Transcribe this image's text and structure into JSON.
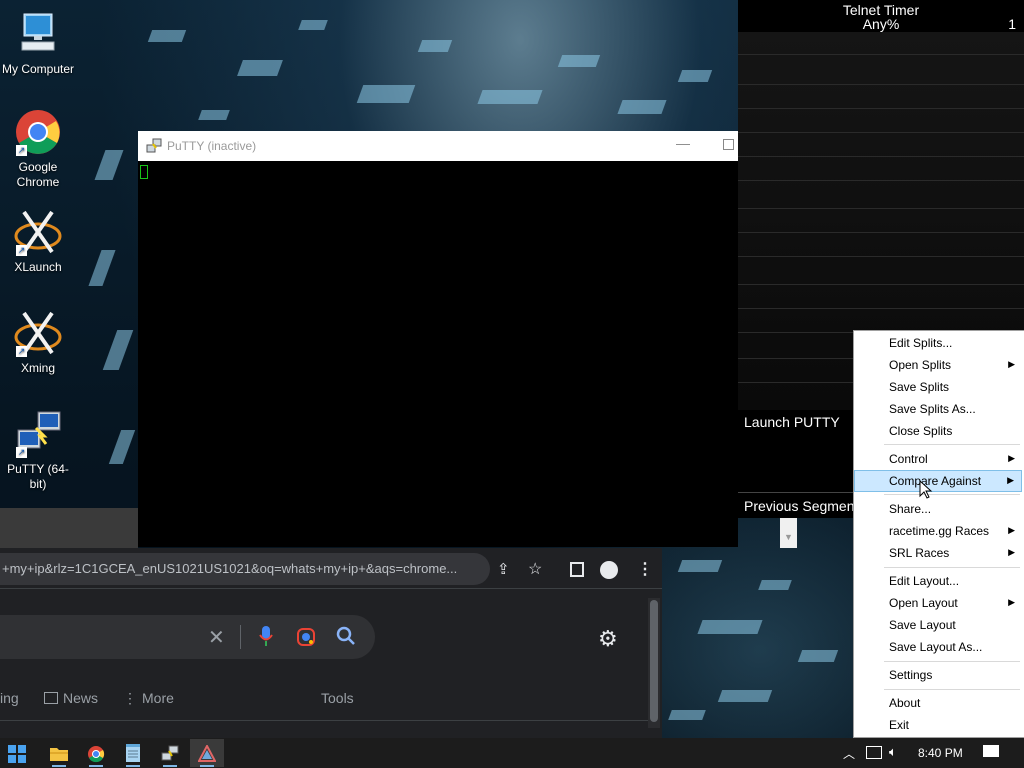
{
  "desktop": {
    "icons": [
      {
        "label": "My Computer"
      },
      {
        "label": "Google Chrome"
      },
      {
        "label": "XLaunch"
      },
      {
        "label": "Xming"
      },
      {
        "label": "PuTTY (64-bit)"
      }
    ]
  },
  "putty": {
    "title": "PuTTY (inactive)",
    "minimize_icon": "minimize-icon",
    "maximize_icon": "maximize-icon"
  },
  "livesplit": {
    "game": "Telnet Timer",
    "category": "Any%",
    "attempts": "1",
    "segment_label": "Launch PUTTY",
    "previous_segment_label": "Previous Segment"
  },
  "context_menu": {
    "items": [
      {
        "label": "Edit Splits...",
        "submenu": false
      },
      {
        "label": "Open Splits",
        "submenu": true
      },
      {
        "label": "Save Splits",
        "submenu": false
      },
      {
        "label": "Save Splits As...",
        "submenu": false
      },
      {
        "label": "Close Splits",
        "submenu": false
      },
      {
        "label": "Control",
        "submenu": true
      },
      {
        "label": "Compare Against",
        "submenu": true,
        "highlighted": true
      },
      {
        "label": "Share...",
        "submenu": false
      },
      {
        "label": "racetime.gg Races",
        "submenu": true
      },
      {
        "label": "SRL Races",
        "submenu": true
      },
      {
        "label": "Edit Layout...",
        "submenu": false
      },
      {
        "label": "Open Layout",
        "submenu": true
      },
      {
        "label": "Save Layout",
        "submenu": false
      },
      {
        "label": "Save Layout As...",
        "submenu": false
      },
      {
        "label": "Settings",
        "submenu": false
      },
      {
        "label": "About",
        "submenu": false
      },
      {
        "label": "Exit",
        "submenu": false
      }
    ],
    "highlight_color": "#cce8ff"
  },
  "chrome": {
    "url": "+my+ip&rlz=1C1GCEA_enUS1021US1021&oq=whats+my+ip+&aqs=chrome...",
    "tabs": [
      {
        "label": "ing"
      },
      {
        "label": "News"
      },
      {
        "label": "More"
      }
    ],
    "tools_label": "Tools"
  },
  "taskbar": {
    "apps": [
      "start-icon",
      "file-explorer-icon",
      "chrome-icon",
      "notepad-icon",
      "putty-icon",
      "livesplit-icon"
    ],
    "time": "8:40 PM"
  },
  "colors": {
    "accent": "#7fb7e6",
    "terminal_cursor": "#19c319",
    "taskbar": "#1c1c1c"
  }
}
